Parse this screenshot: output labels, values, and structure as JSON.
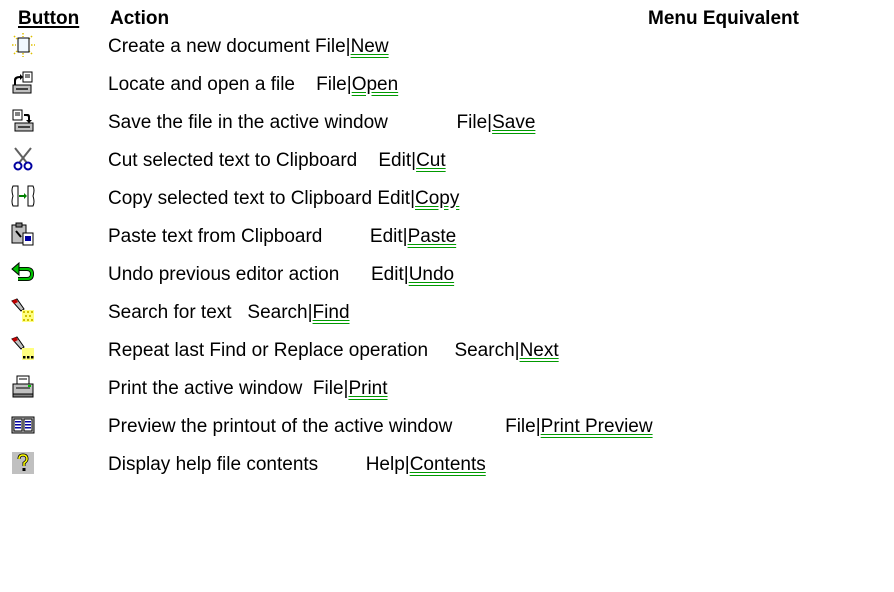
{
  "header": {
    "button": "Button",
    "action": "Action",
    "menu_equivalent": "Menu Equivalent"
  },
  "rows": [
    {
      "icon": "new-document-icon",
      "action": "Create a new document",
      "gap": " ",
      "menu": "File|",
      "link": "New"
    },
    {
      "icon": "open-file-icon",
      "action": "Locate and open a file",
      "gap": "    ",
      "menu": "File|",
      "link": "Open"
    },
    {
      "icon": "save-file-icon",
      "action": "Save the file in the active window",
      "gap": "             ",
      "menu": "File|",
      "link": "Save"
    },
    {
      "icon": "scissors-icon",
      "action": "Cut selected text to Clipboard",
      "gap": "    ",
      "menu": "Edit|",
      "link": "Cut"
    },
    {
      "icon": "copy-icon",
      "action": "Copy selected text to Clipboard",
      "gap": " ",
      "menu": "Edit|",
      "link": "Copy"
    },
    {
      "icon": "paste-icon",
      "action": "Paste text from Clipboard",
      "gap": "         ",
      "menu": "Edit|",
      "link": "Paste"
    },
    {
      "icon": "undo-icon",
      "action": "Undo previous editor action",
      "gap": "      ",
      "menu": "Edit|",
      "link": "Undo"
    },
    {
      "icon": "flashlight-find-icon",
      "action": "Search for text",
      "gap": "   ",
      "menu": "Search|",
      "link": "Find"
    },
    {
      "icon": "flashlight-next-icon",
      "action": "Repeat last Find or Replace operation",
      "gap": "     ",
      "menu": "Search|",
      "link": "Next"
    },
    {
      "icon": "printer-icon",
      "action": "Print the active window",
      "gap": "  ",
      "menu": "File|",
      "link": "Print"
    },
    {
      "icon": "print-preview-icon",
      "action": "Preview the printout of the active window",
      "gap": "          ",
      "menu": "File|",
      "link": "Print Preview"
    },
    {
      "icon": "help-question-icon",
      "action": "Display help file contents",
      "gap": "         ",
      "menu": "Help|",
      "link": "Contents"
    }
  ]
}
